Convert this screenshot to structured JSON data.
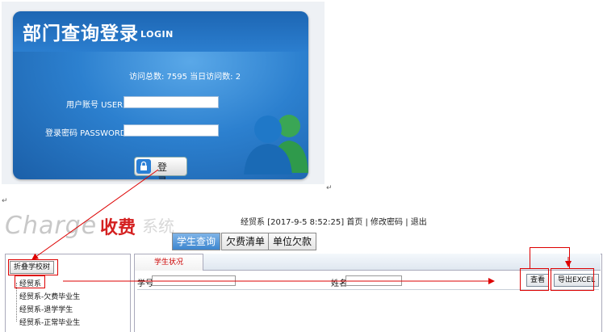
{
  "login": {
    "title": "部门查询登录",
    "title_en": "LOGIN",
    "stats": "访问总数: 7595 当日访问数: 2",
    "user_label": "用户账号 USER:",
    "password_label": "登录密码 PASSWORD:",
    "login_button": "登 录",
    "colors": {
      "panel": "#2c80cf",
      "dark": "#1b5fa8"
    }
  },
  "system": {
    "logo_en": "Charge",
    "logo_cn": "收费",
    "logo_cn_suffix": "系统",
    "top_info": {
      "department": "经贸系",
      "timestamp": "[2017-9-5 8:52:25]",
      "home": "首页",
      "sep1": "|",
      "change_password": "修改密码",
      "sep2": "|",
      "logout": "退出"
    },
    "tabs": [
      {
        "label": "学生查询",
        "active": true
      },
      {
        "label": "欠费清单",
        "active": false
      },
      {
        "label": "单位欠款",
        "active": false
      }
    ],
    "sidebar": {
      "collapse_button": "折叠学校树",
      "tree": [
        {
          "label": "经贸系"
        },
        {
          "label": "经贸系-欠费毕业生"
        },
        {
          "label": "经贸系-退学学生"
        },
        {
          "label": "经贸系-正常毕业生"
        }
      ]
    },
    "content": {
      "subtab": "学生状况",
      "student_id_label": "学号",
      "name_label": "姓名",
      "view_button": "查看",
      "export_button": "导出EXCEL"
    },
    "colors": {
      "annotation": "#dd0000",
      "active_tab": "#3d86cf"
    }
  },
  "paragraph_marks": [
    "↵",
    "↵"
  ]
}
